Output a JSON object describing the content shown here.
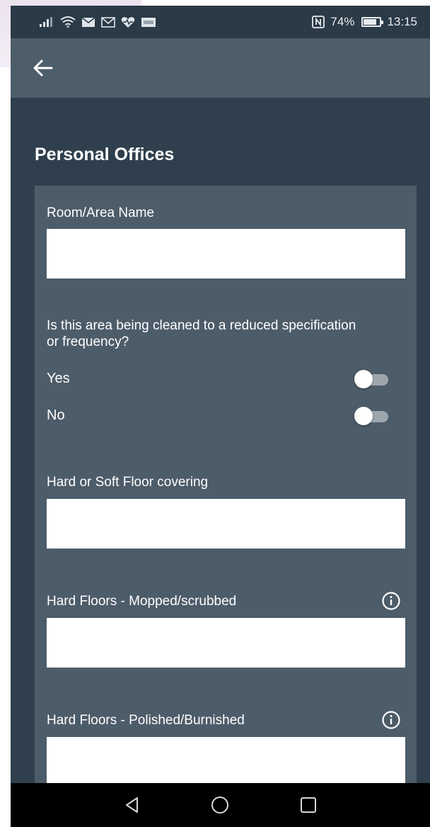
{
  "status_bar": {
    "signal_icon": "signal-icon",
    "wifi_icon": "wifi-icon",
    "notification_icons": [
      "mail-icon",
      "gmail-icon",
      "health-icon",
      "ebay-icon"
    ],
    "nfc_icon": "nfc-icon",
    "battery": "74%",
    "time": "13:15"
  },
  "app_bar": {
    "back_icon": "arrow-left-icon"
  },
  "page": {
    "title": "Personal Offices"
  },
  "form": {
    "room_name": {
      "label": "Room/Area Name",
      "value": ""
    },
    "reduced_spec": {
      "question": "Is this area being cleaned to a reduced specification or frequency?",
      "options": [
        {
          "label": "Yes",
          "on": false
        },
        {
          "label": "No",
          "on": false
        }
      ]
    },
    "floor_covering": {
      "label": "Hard or Soft Floor covering",
      "value": ""
    },
    "mopped": {
      "label": "Hard Floors - Mopped/scrubbed",
      "value": "",
      "info_icon": "info-icon"
    },
    "polished": {
      "label": "Hard Floors - Polished/Burnished",
      "value": "",
      "info_icon": "info-icon"
    }
  },
  "nav_bar": {
    "back": "triangle-back-icon",
    "home": "circle-home-icon",
    "recents": "square-recents-icon"
  },
  "colors": {
    "background": "#2f3f4d",
    "app_bar": "#4e5d6a",
    "card": "#4d5c69",
    "input": "#ffffff"
  }
}
